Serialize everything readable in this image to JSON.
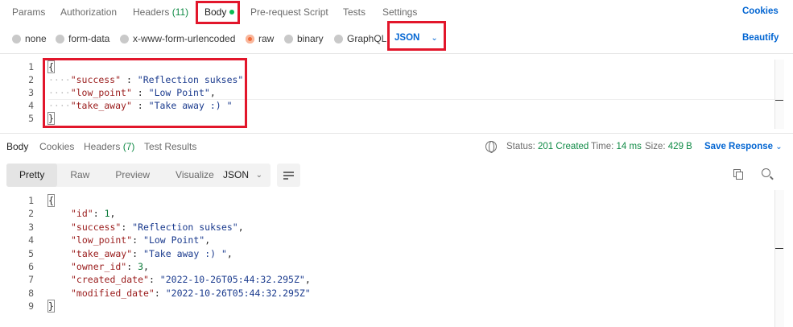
{
  "request_tabs": {
    "params": "Params",
    "authorization": "Authorization",
    "headers": "Headers",
    "headers_count": "(11)",
    "body": "Body",
    "prerequest": "Pre-request Script",
    "tests": "Tests",
    "settings": "Settings",
    "cookies": "Cookies"
  },
  "body_types": {
    "none": "none",
    "form_data": "form-data",
    "urlencoded": "x-www-form-urlencoded",
    "raw": "raw",
    "binary": "binary",
    "graphql": "GraphQL",
    "language": "JSON",
    "beautify": "Beautify"
  },
  "request_body": {
    "line_numbers": [
      "1",
      "2",
      "3",
      "4",
      "5"
    ],
    "open_brace": "{",
    "close_brace": "}",
    "rows": [
      {
        "key": "\"success\"",
        "sep": " : ",
        "value": "\"Reflection sukses\"",
        "end": ","
      },
      {
        "key": "\"low_point\"",
        "sep": " : ",
        "value": "\"Low Point\"",
        "end": ","
      },
      {
        "key": "\"take_away\"",
        "sep": " : ",
        "value": "\"Take away :) \"",
        "end": ""
      }
    ]
  },
  "response_tabs": {
    "body": "Body",
    "cookies": "Cookies",
    "headers": "Headers",
    "headers_count": "(7)",
    "test_results": "Test Results"
  },
  "response_meta": {
    "status_label": "Status:",
    "status_value": "201 Created",
    "time_label": "Time:",
    "time_value": "14 ms",
    "size_label": "Size:",
    "size_value": "429 B",
    "save_response": "Save Response"
  },
  "view_modes": {
    "pretty": "Pretty",
    "raw": "Raw",
    "preview": "Preview",
    "visualize": "Visualize",
    "format": "JSON"
  },
  "response_body": {
    "line_numbers": [
      "1",
      "2",
      "3",
      "4",
      "5",
      "6",
      "7",
      "8",
      "9"
    ],
    "open_brace": "{",
    "close_brace": "}",
    "rows": [
      {
        "key": "\"id\"",
        "sep": ": ",
        "value": "1",
        "type": "num",
        "end": ","
      },
      {
        "key": "\"success\"",
        "sep": ": ",
        "value": "\"Reflection sukses\"",
        "type": "str",
        "end": ","
      },
      {
        "key": "\"low_point\"",
        "sep": ": ",
        "value": "\"Low Point\"",
        "type": "str",
        "end": ","
      },
      {
        "key": "\"take_away\"",
        "sep": ": ",
        "value": "\"Take away :) \"",
        "type": "str",
        "end": ","
      },
      {
        "key": "\"owner_id\"",
        "sep": ": ",
        "value": "3",
        "type": "num",
        "end": ","
      },
      {
        "key": "\"created_date\"",
        "sep": ": ",
        "value": "\"2022-10-26T05:44:32.295Z\"",
        "type": "str",
        "end": ","
      },
      {
        "key": "\"modified_date\"",
        "sep": ": ",
        "value": "\"2022-10-26T05:44:32.295Z\"",
        "type": "str",
        "end": ""
      }
    ]
  },
  "colors": {
    "accent_blue": "#0265d2",
    "status_green": "#0f8a45",
    "raw_orange": "#f26b3a",
    "highlight_red": "#e2162b"
  }
}
